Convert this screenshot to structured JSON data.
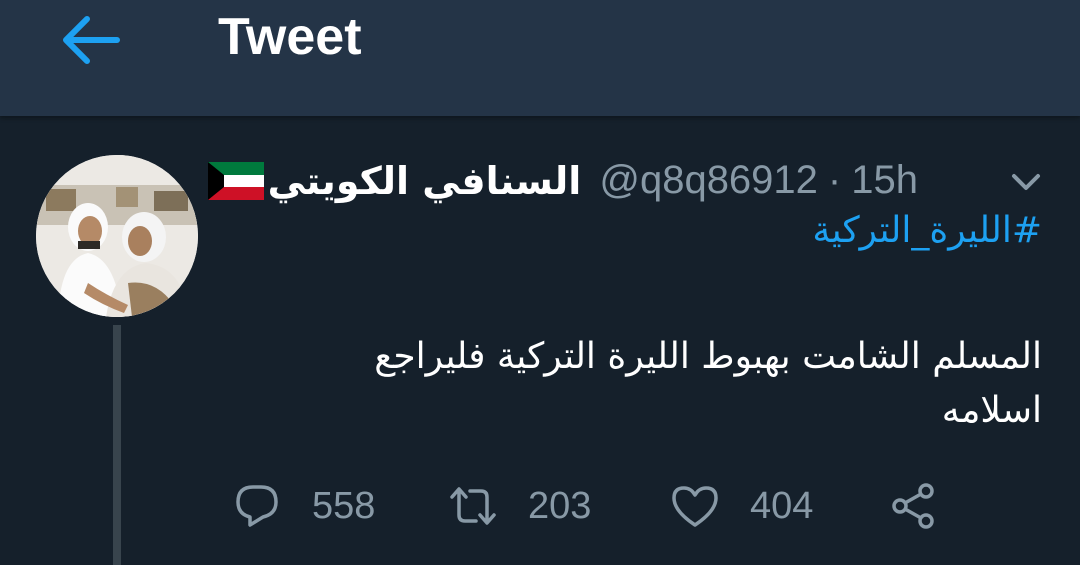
{
  "header": {
    "title": "Tweet",
    "back_icon": "arrow-left-icon"
  },
  "colors": {
    "background": "#15202b",
    "header_bg": "#243447",
    "accent": "#1da1f2",
    "secondary_text": "#8899a6"
  },
  "tweet": {
    "display_name": "السنافي الكويتي",
    "flag_icon": "kuwait-flag-icon",
    "handle": "@q8q86912",
    "separator": "·",
    "time": "15h",
    "menu_icon": "chevron-down-icon",
    "hashtag": "#الليرة_التركية",
    "text_line1": "المسلم الشامت بهبوط الليرة التركية فليراجع",
    "text_line2": "اسلامه"
  },
  "actions": {
    "replies": "558",
    "retweets": "203",
    "likes": "404",
    "icons": [
      "reply-icon",
      "retweet-icon",
      "like-icon",
      "share-icon"
    ]
  }
}
